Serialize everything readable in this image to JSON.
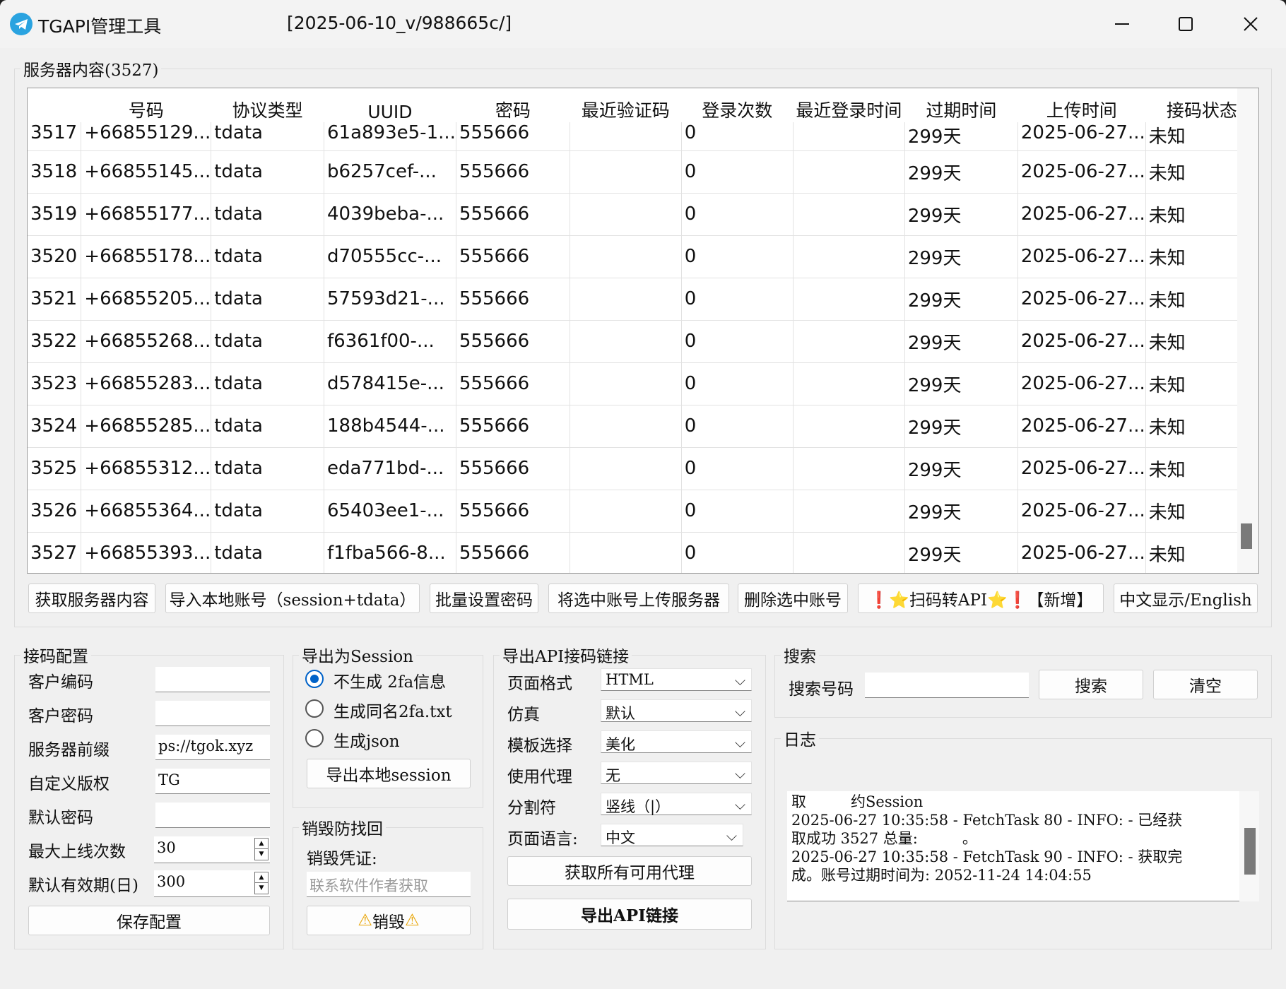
{
  "window": {
    "title": "TGAPI管理工具",
    "version": "[2025-06-10_v/988665c/]",
    "minimize_icon": "minimize-icon",
    "maximize_icon": "maximize-icon",
    "close_icon": "close-icon",
    "app_icon": "telegram-icon"
  },
  "server_group": {
    "label": "服务器内容(3527)",
    "columns": [
      "",
      "号码",
      "协议类型",
      "UUID",
      "密码",
      "最近验证码",
      "登录次数",
      "最近登录时间",
      "过期时间",
      "上传时间",
      "接码状态"
    ],
    "rows": [
      [
        "3517",
        "+66855129...",
        "tdata",
        "61a893e5-1...",
        "555666",
        "",
        "0",
        "",
        "299天",
        "2025-06-27...",
        "未知"
      ],
      [
        "3518",
        "+66855145...",
        "tdata",
        "b6257cef-...",
        "555666",
        "",
        "0",
        "",
        "299天",
        "2025-06-27...",
        "未知"
      ],
      [
        "3519",
        "+66855177...",
        "tdata",
        "4039beba-...",
        "555666",
        "",
        "0",
        "",
        "299天",
        "2025-06-27...",
        "未知"
      ],
      [
        "3520",
        "+66855178...",
        "tdata",
        "d70555cc-...",
        "555666",
        "",
        "0",
        "",
        "299天",
        "2025-06-27...",
        "未知"
      ],
      [
        "3521",
        "+66855205...",
        "tdata",
        "57593d21-...",
        "555666",
        "",
        "0",
        "",
        "299天",
        "2025-06-27...",
        "未知"
      ],
      [
        "3522",
        "+66855268...",
        "tdata",
        "f6361f00-...",
        "555666",
        "",
        "0",
        "",
        "299天",
        "2025-06-27...",
        "未知"
      ],
      [
        "3523",
        "+66855283...",
        "tdata",
        "d578415e-...",
        "555666",
        "",
        "0",
        "",
        "299天",
        "2025-06-27...",
        "未知"
      ],
      [
        "3524",
        "+66855285...",
        "tdata",
        "188b4544-...",
        "555666",
        "",
        "0",
        "",
        "299天",
        "2025-06-27...",
        "未知"
      ],
      [
        "3525",
        "+66855312...",
        "tdata",
        "eda771bd-...",
        "555666",
        "",
        "0",
        "",
        "299天",
        "2025-06-27...",
        "未知"
      ],
      [
        "3526",
        "+66855364...",
        "tdata",
        "65403ee1-...",
        "555666",
        "",
        "0",
        "",
        "299天",
        "2025-06-27...",
        "未知"
      ],
      [
        "3527",
        "+66855393...",
        "tdata",
        "f1fba566-8...",
        "555666",
        "",
        "0",
        "",
        "299天",
        "2025-06-27...",
        "未知"
      ]
    ],
    "buttons": {
      "fetch": "获取服务器内容",
      "import": "导入本地账号（session+tdata）",
      "batch_password": "批量设置密码",
      "upload": "将选中账号上传服务器",
      "delete": "删除选中账号",
      "qr_new": "❗⭐扫码转API⭐❗【新增】",
      "language": "中文显示/English"
    }
  },
  "code_config": {
    "label": "接码配置",
    "customer_code_label": "客户编码",
    "customer_code_value": "",
    "customer_password_label": "客户密码",
    "customer_password_value": "",
    "server_prefix_label": "服务器前缀",
    "server_prefix_value": "ps://tgok.xyz",
    "copyright_label": "自定义版权",
    "copyright_value": "TG",
    "default_password_label": "默认密码",
    "default_password_value": "",
    "max_logins_label": "最大上线次数",
    "max_logins_value": "30",
    "validity_label": "默认有效期(日)",
    "validity_value": "300",
    "save_button": "保存配置"
  },
  "export_session": {
    "label": "导出为Session",
    "options": [
      "不生成 2fa信息",
      "生成同名2fa.txt",
      "生成json"
    ],
    "selected_option": "不生成 2fa信息",
    "export_button": "导出本地session"
  },
  "destroy": {
    "label": "销毁防找回",
    "credential_label": "销毁凭证:",
    "credential_placeholder": "联系软件作者获取",
    "destroy_button": "销毁",
    "warning_icon": "warning-icon"
  },
  "export_api": {
    "label": "导出API接码链接",
    "page_format_label": "页面格式",
    "page_format_value": "HTML",
    "emulate_label": "仿真",
    "emulate_value": "默认",
    "template_label": "模板选择",
    "template_value": "美化",
    "proxy_label": "使用代理",
    "proxy_value": "无",
    "separator_label": "分割符",
    "separator_value": "竖线（|）",
    "page_lang_label": "页面语言:",
    "page_lang_value": "中文",
    "get_proxies_button": "获取所有可用代理",
    "export_button": "导出API链接"
  },
  "search": {
    "label": "搜索",
    "number_label": "搜索号码",
    "number_value": "",
    "search_button": "搜索",
    "clear_button": "清空"
  },
  "log": {
    "label": "日志",
    "lines": [
      "取　　　约Session",
      "2025-06-27 10:35:58 - FetchTask 80 - INFO: - 已经获",
      "取成功 3527 总量:　　　。",
      "2025-06-27 10:35:58 - FetchTask 90 - INFO: - 获取完",
      "成。账号过期时间为: 2052-11-24 14:04:55"
    ]
  }
}
